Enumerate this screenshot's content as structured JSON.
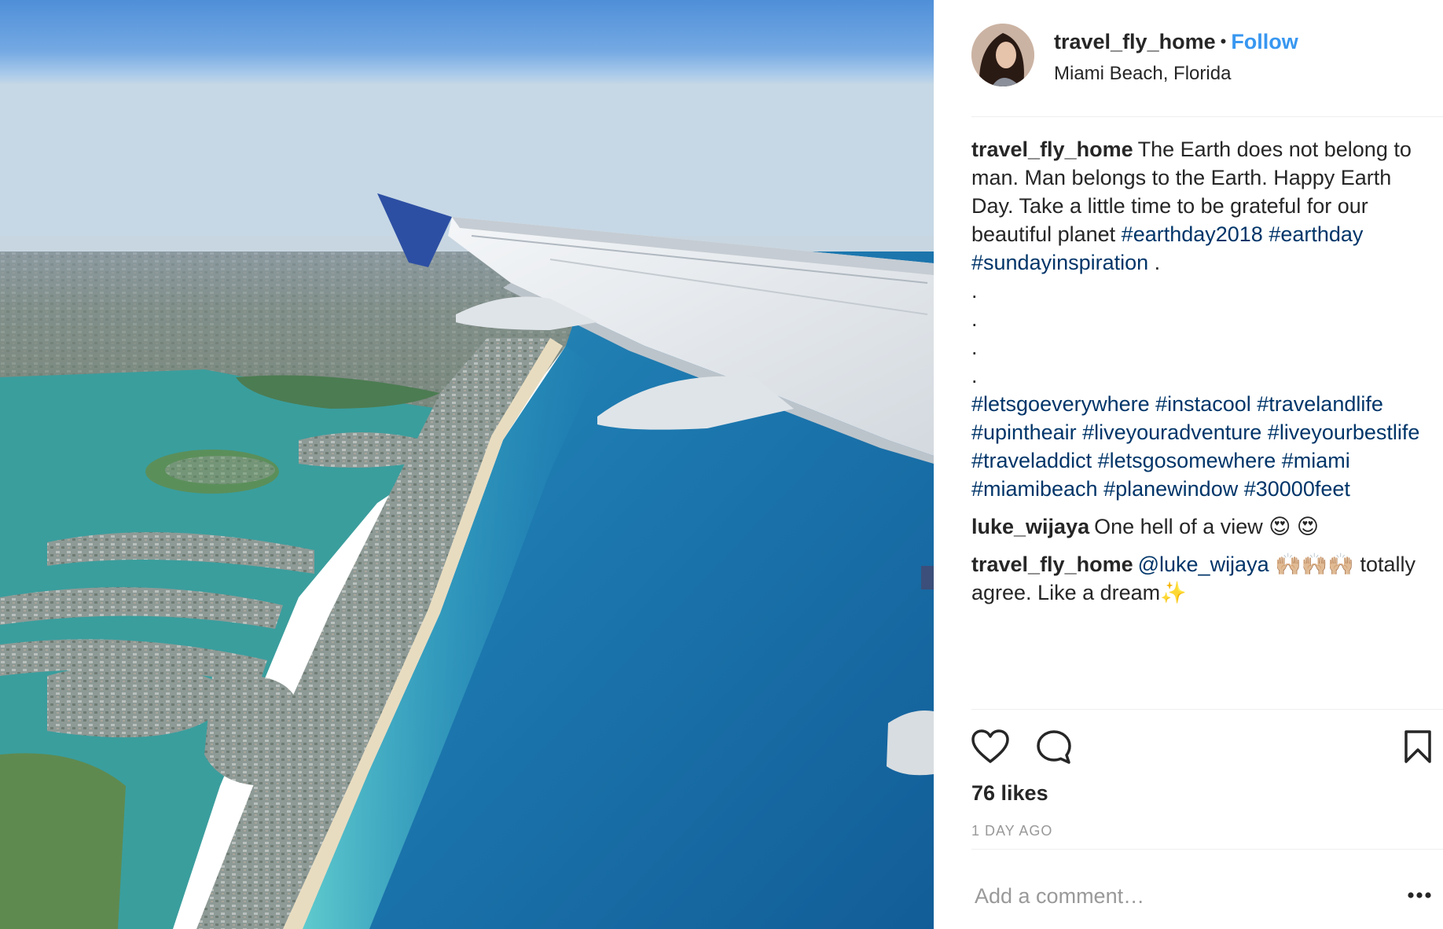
{
  "post": {
    "author": {
      "username": "travel_fly_home",
      "location": "Miami Beach, Florida",
      "follow_label": "Follow"
    },
    "caption": {
      "username": "travel_fly_home",
      "text": "The Earth does not belong to man. Man belongs to the Earth. Happy Earth Day. Take a little time to be grateful for our beautiful planet",
      "hashtags_line1": [
        "#earthday2018",
        "#earthday",
        "#sundayinspiration"
      ],
      "trailing": ".",
      "dot_lines": [
        ".",
        ".",
        ".",
        "."
      ],
      "hashtags_block": [
        "#letsgoeverywhere",
        "#instacool",
        "#travelandlife",
        "#upintheair",
        "#liveyouradventure",
        "#liveyourbestlife",
        "#traveladdict",
        "#letsgosomewhere",
        "#miami",
        "#miamibeach",
        "#planewindow",
        "#30000feet"
      ]
    },
    "comments": [
      {
        "username": "luke_wijaya",
        "text": "One hell of a view",
        "emoji": "😍 😍"
      },
      {
        "username": "travel_fly_home",
        "mention": "@luke_wijaya",
        "emoji_1": "🙌🏼🙌🏼🙌🏼",
        "text": "totally agree. Like a dream",
        "emoji_2": "✨"
      }
    ],
    "likes": "76 likes",
    "time": "1 DAY AGO",
    "add_comment_placeholder": "Add a comment…"
  },
  "icons": {
    "like": "heart-icon",
    "comment": "comment-bubble-icon",
    "save": "bookmark-icon",
    "more": "more-options-icon"
  },
  "colors": {
    "link_blue": "#3897f0",
    "hashtag_blue": "#003569",
    "muted_gray": "#999999",
    "text": "#262626"
  }
}
